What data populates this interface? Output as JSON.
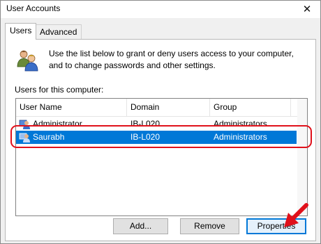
{
  "window": {
    "title": "User Accounts",
    "close_glyph": "✕"
  },
  "tabs": [
    {
      "label": "Users",
      "active": true
    },
    {
      "label": "Advanced",
      "active": false
    }
  ],
  "intro_text": "Use the list below to grant or deny users access to your computer, and to change passwords and other settings.",
  "list_label": "Users for this computer:",
  "columns": [
    "User Name",
    "Domain",
    "Group"
  ],
  "rows": [
    {
      "user": "Administrator",
      "domain": "IB-L020",
      "group": "Administrators",
      "selected": false
    },
    {
      "user": "Saurabh",
      "domain": "IB-L020",
      "group": "Administrators",
      "selected": true
    }
  ],
  "buttons": {
    "add": "Add...",
    "remove": "Remove",
    "properties": "Properties"
  },
  "colors": {
    "selection": "#0078d7",
    "annotation": "#e0101a"
  },
  "icons": {
    "users": "users-icon",
    "user_row": "user-icon",
    "close": "close-icon",
    "arrow": "arrow-annotation"
  }
}
